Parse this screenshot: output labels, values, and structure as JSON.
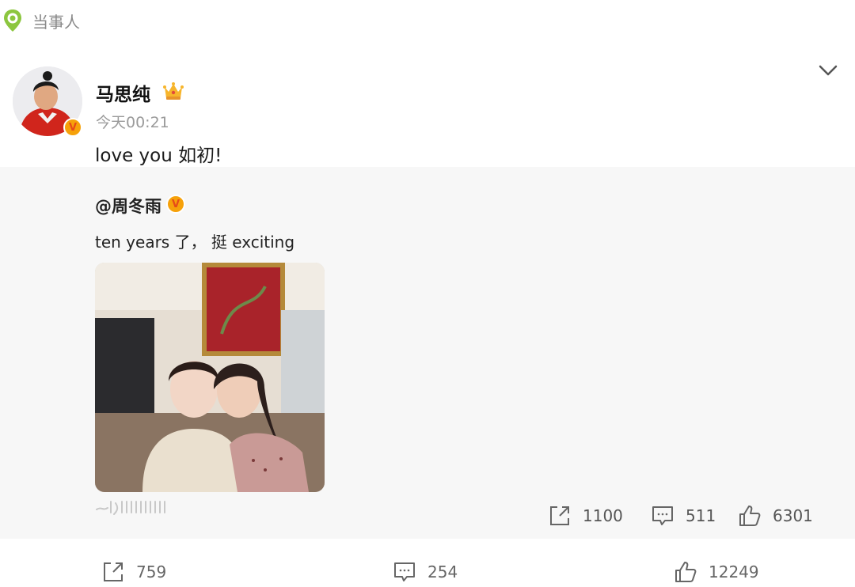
{
  "topic": {
    "label": "当事人",
    "icon": "location-pin-icon"
  },
  "post": {
    "author": "马思纯",
    "badge_letter": "V",
    "time": "今天00:21",
    "text": "love you 如初!"
  },
  "repost": {
    "author": "@周冬雨",
    "badge_letter": "V",
    "text": "ten years 了， 挺 exciting",
    "stats": {
      "share": "1100",
      "comment": "511",
      "like": "6301"
    }
  },
  "bottom_bar": {
    "share": "759",
    "comment": "254",
    "like": "12249"
  },
  "colors": {
    "badge": "#f6a10a",
    "badge_text": "#e64a19",
    "topic_icon": "#8cc63f",
    "repost_bg": "#f7f7f7"
  }
}
